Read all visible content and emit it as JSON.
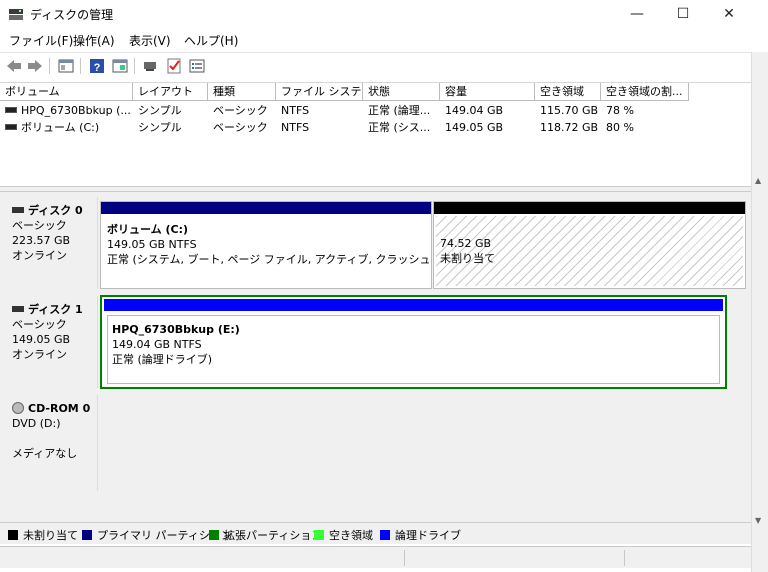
{
  "window": {
    "title": "ディスクの管理",
    "buttons": {
      "minimize": "—",
      "maximize": "☐",
      "close": "✕"
    }
  },
  "menu": {
    "items": [
      "ファイル(F)",
      "操作(A)",
      "表示(V)",
      "ヘルプ(H)"
    ]
  },
  "toolbar": {
    "icons": [
      "back-arrow-icon",
      "forward-arrow-icon",
      "console-tree-icon",
      "help-icon",
      "properties-icon",
      "connect-icon",
      "check-icon",
      "list-view-icon"
    ]
  },
  "volume_list": {
    "columns": [
      "ボリューム",
      "レイアウト",
      "種類",
      "ファイル システム",
      "状態",
      "容量",
      "空き領域",
      "空き領域の割..."
    ],
    "rows": [
      [
        "HPQ_6730Bbkup (...",
        "シンプル",
        "ベーシック",
        "NTFS",
        "正常 (論理...",
        "149.04 GB",
        "115.70 GB",
        "78 %"
      ],
      [
        "ボリューム (C:)",
        "シンプル",
        "ベーシック",
        "NTFS",
        "正常 (シス...",
        "149.05 GB",
        "118.72 GB",
        "80 %"
      ]
    ]
  },
  "disks": [
    {
      "name": "ディスク 0",
      "type": "ベーシック",
      "size": "223.57 GB",
      "status": "オンライン",
      "partitions": [
        {
          "title": "ボリューム (C:)",
          "size": "149.05 GB NTFS",
          "status": "正常 (システム, ブート, ページ ファイル, アクティブ, クラッシュ ダンプ, プラ"
        },
        {
          "title": "",
          "size": "74.52 GB",
          "status": "未割り当て"
        }
      ]
    },
    {
      "name": "ディスク 1",
      "type": "ベーシック",
      "size": "149.05 GB",
      "status": "オンライン",
      "partitions": [
        {
          "title": "HPQ_6730Bbkup (E:)",
          "size": "149.04 GB NTFS",
          "status": "正常 (論理ドライブ)"
        }
      ]
    },
    {
      "name": "CD-ROM 0",
      "type": "DVD (D:)",
      "size": "",
      "status": "メディアなし",
      "partitions": []
    }
  ],
  "legend": [
    {
      "label": "未割り当て",
      "color": "#000000"
    },
    {
      "label": "プライマリ パーティション",
      "color": "#000080"
    },
    {
      "label": "拡張パーティション",
      "color": "#008000"
    },
    {
      "label": "空き領域",
      "color": "#33ff33"
    },
    {
      "label": "論理ドライブ",
      "color": "#0000ff"
    }
  ],
  "colors": {
    "primary": "#000080",
    "unallocated": "#000000",
    "extended": "#008000",
    "logical": "#0000ff"
  }
}
